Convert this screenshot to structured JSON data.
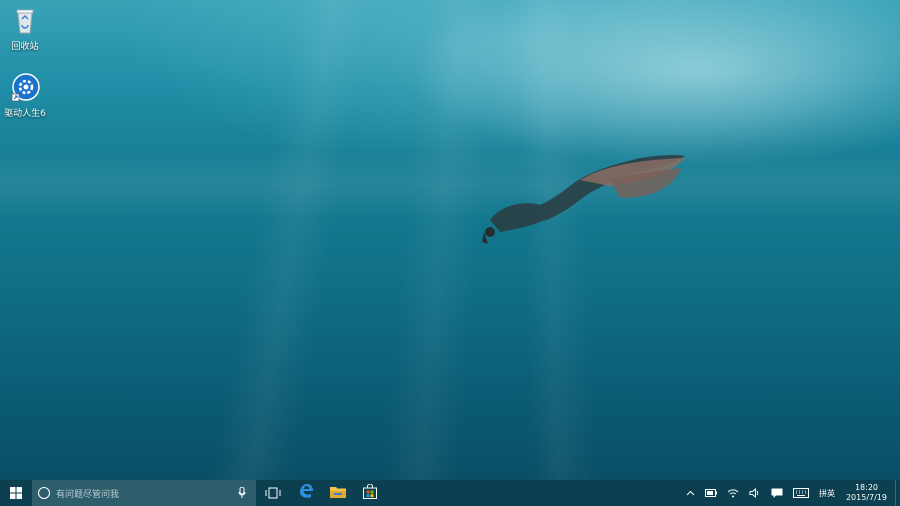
{
  "desktop": {
    "icons": [
      {
        "label": "回收站",
        "icon": "recycle-bin-icon"
      },
      {
        "label": "驱动人生6",
        "icon": "gear-icon"
      }
    ]
  },
  "taskbar": {
    "start_icon": "windows-logo-icon",
    "search": {
      "placeholder": "有问题尽管问我",
      "icon": "cortana-circle-icon",
      "mic_icon": "microphone-icon"
    },
    "task_view_icon": "task-view-icon",
    "pinned": [
      {
        "name": "edge",
        "icon": "edge-icon"
      },
      {
        "name": "file-explorer",
        "icon": "folder-icon"
      },
      {
        "name": "store",
        "icon": "store-icon"
      }
    ],
    "tray": {
      "ime_label": "拼英",
      "time": "18:20",
      "date": "2015/7/19"
    }
  },
  "colors": {
    "taskbar": "#0c3f4f",
    "search_bg": "#2e5e6c",
    "edge_blue": "#2f8fe0",
    "folder_yellow": "#f2c14e"
  }
}
